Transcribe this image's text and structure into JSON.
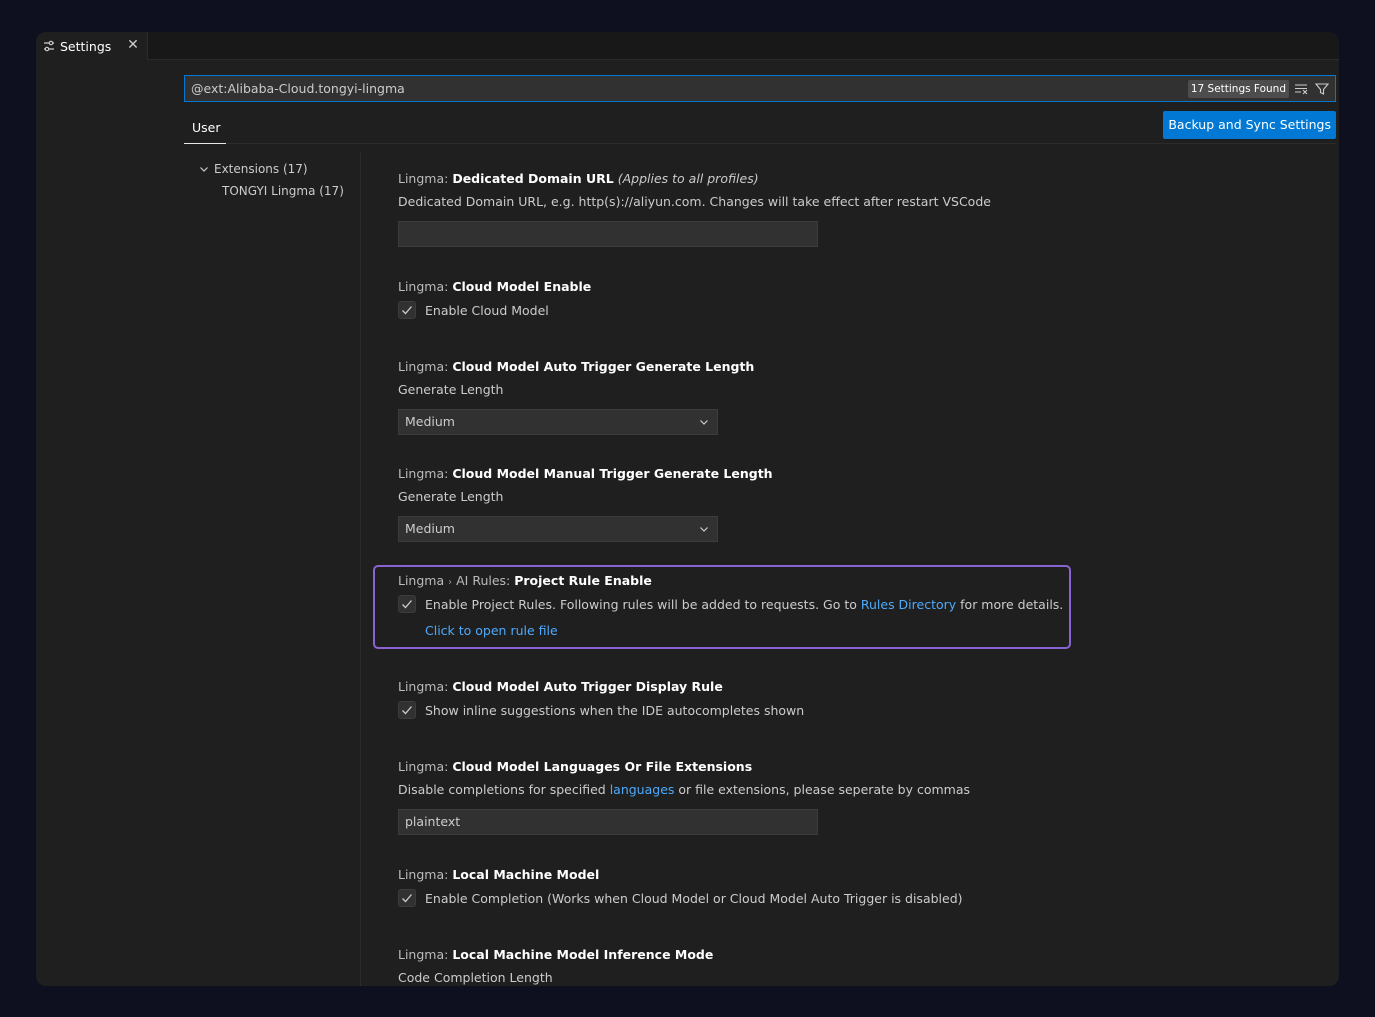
{
  "tab": {
    "label": "Settings",
    "close": "✕"
  },
  "search": {
    "value": "@ext:Alibaba-Cloud.tongyi-lingma",
    "found": "17 Settings Found"
  },
  "scope": {
    "user": "User",
    "sync": "Backup and Sync Settings"
  },
  "toc": [
    {
      "label": "Extensions (17)"
    },
    {
      "label": "TONGYI Lingma (17)"
    }
  ],
  "settings": {
    "s1": {
      "category": "Lingma: ",
      "name": "Dedicated Domain URL",
      "hint": "(Applies to all profiles)",
      "description": "Dedicated Domain URL, e.g. http(s)://aliyun.com. Changes will take effect after restart VSCode",
      "value": ""
    },
    "s2": {
      "category": "Lingma: ",
      "name": "Cloud Model Enable",
      "checkbox_label": "Enable Cloud Model",
      "checked": true
    },
    "s3": {
      "category": "Lingma: ",
      "name": "Cloud Model Auto Trigger Generate Length",
      "description": "Generate Length",
      "value": "Medium"
    },
    "s4": {
      "category": "Lingma: ",
      "name": "Cloud Model Manual Trigger Generate Length",
      "description": "Generate Length",
      "value": "Medium"
    },
    "s5": {
      "category": "Lingma",
      "separator": "›",
      "subcategory": "AI Rules: ",
      "name": "Project Rule Enable",
      "checkbox_label_before": "Enable Project Rules. Following rules will be added to requests. Go to ",
      "link": "Rules Directory",
      "checkbox_label_after": " for more details.",
      "checked": true,
      "action_link": "Click to open rule file"
    },
    "s6": {
      "category": "Lingma: ",
      "name": "Cloud Model Auto Trigger Display Rule",
      "checkbox_label": "Show inline suggestions when the IDE autocompletes shown",
      "checked": true
    },
    "s7": {
      "category": "Lingma: ",
      "name": "Cloud Model Languages Or File Extensions",
      "description_before": "Disable completions for specified ",
      "link": "languages",
      "description_after": " or file extensions, please seperate by commas",
      "value": "plaintext"
    },
    "s8": {
      "category": "Lingma: ",
      "name": "Local Machine Model",
      "checkbox_label": "Enable Completion (Works when Cloud Model or Cloud Model Auto Trigger is disabled)",
      "checked": true
    },
    "s9": {
      "category": "Lingma: ",
      "name": "Local Machine Model Inference Mode",
      "description": "Code Completion Length"
    }
  },
  "colors": {
    "accent": "#0078d4",
    "highlight": "#8a63d2",
    "link": "#4daafc"
  }
}
